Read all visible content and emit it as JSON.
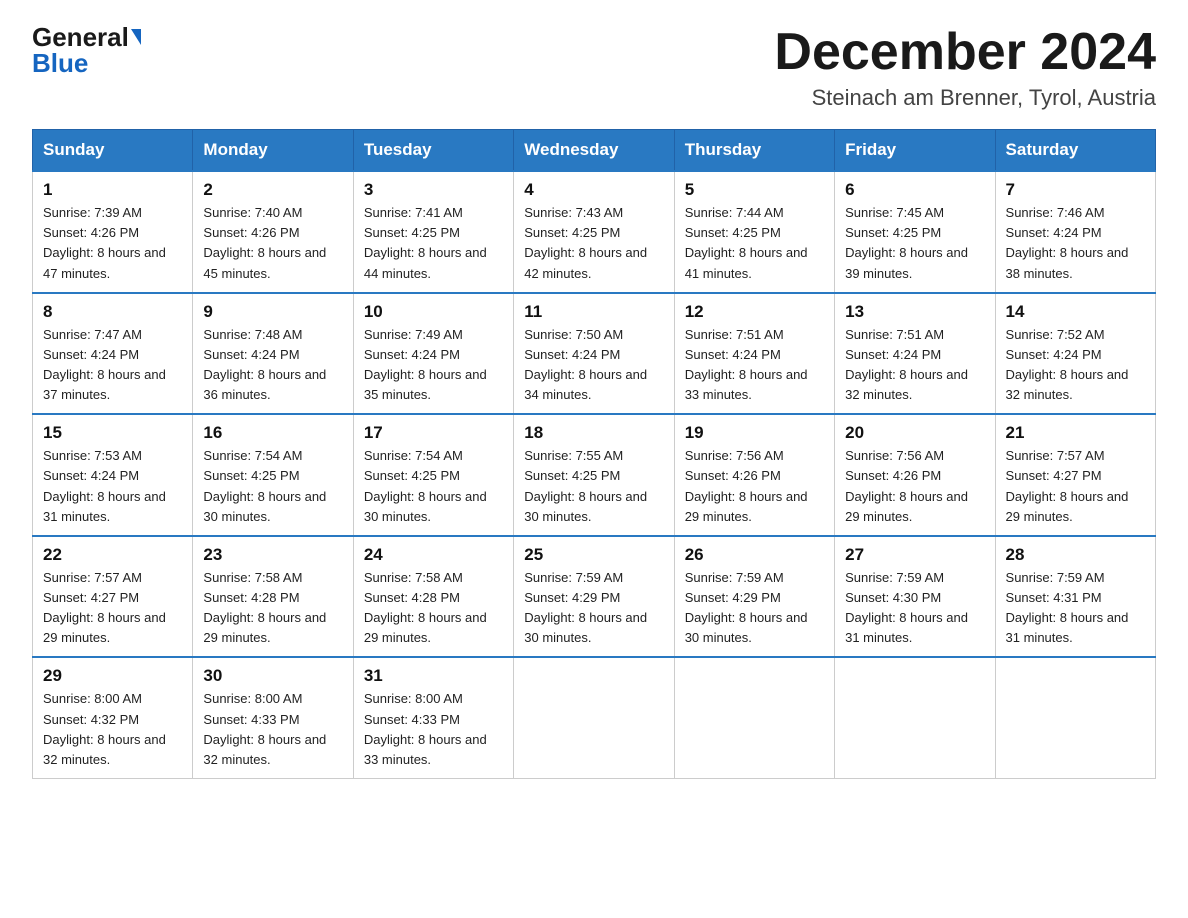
{
  "logo": {
    "general": "General",
    "blue": "Blue"
  },
  "title": "December 2024",
  "location": "Steinach am Brenner, Tyrol, Austria",
  "weekdays": [
    "Sunday",
    "Monday",
    "Tuesday",
    "Wednesday",
    "Thursday",
    "Friday",
    "Saturday"
  ],
  "weeks": [
    [
      {
        "day": "1",
        "sunrise": "7:39 AM",
        "sunset": "4:26 PM",
        "daylight": "8 hours and 47 minutes."
      },
      {
        "day": "2",
        "sunrise": "7:40 AM",
        "sunset": "4:26 PM",
        "daylight": "8 hours and 45 minutes."
      },
      {
        "day": "3",
        "sunrise": "7:41 AM",
        "sunset": "4:25 PM",
        "daylight": "8 hours and 44 minutes."
      },
      {
        "day": "4",
        "sunrise": "7:43 AM",
        "sunset": "4:25 PM",
        "daylight": "8 hours and 42 minutes."
      },
      {
        "day": "5",
        "sunrise": "7:44 AM",
        "sunset": "4:25 PM",
        "daylight": "8 hours and 41 minutes."
      },
      {
        "day": "6",
        "sunrise": "7:45 AM",
        "sunset": "4:25 PM",
        "daylight": "8 hours and 39 minutes."
      },
      {
        "day": "7",
        "sunrise": "7:46 AM",
        "sunset": "4:24 PM",
        "daylight": "8 hours and 38 minutes."
      }
    ],
    [
      {
        "day": "8",
        "sunrise": "7:47 AM",
        "sunset": "4:24 PM",
        "daylight": "8 hours and 37 minutes."
      },
      {
        "day": "9",
        "sunrise": "7:48 AM",
        "sunset": "4:24 PM",
        "daylight": "8 hours and 36 minutes."
      },
      {
        "day": "10",
        "sunrise": "7:49 AM",
        "sunset": "4:24 PM",
        "daylight": "8 hours and 35 minutes."
      },
      {
        "day": "11",
        "sunrise": "7:50 AM",
        "sunset": "4:24 PM",
        "daylight": "8 hours and 34 minutes."
      },
      {
        "day": "12",
        "sunrise": "7:51 AM",
        "sunset": "4:24 PM",
        "daylight": "8 hours and 33 minutes."
      },
      {
        "day": "13",
        "sunrise": "7:51 AM",
        "sunset": "4:24 PM",
        "daylight": "8 hours and 32 minutes."
      },
      {
        "day": "14",
        "sunrise": "7:52 AM",
        "sunset": "4:24 PM",
        "daylight": "8 hours and 32 minutes."
      }
    ],
    [
      {
        "day": "15",
        "sunrise": "7:53 AM",
        "sunset": "4:24 PM",
        "daylight": "8 hours and 31 minutes."
      },
      {
        "day": "16",
        "sunrise": "7:54 AM",
        "sunset": "4:25 PM",
        "daylight": "8 hours and 30 minutes."
      },
      {
        "day": "17",
        "sunrise": "7:54 AM",
        "sunset": "4:25 PM",
        "daylight": "8 hours and 30 minutes."
      },
      {
        "day": "18",
        "sunrise": "7:55 AM",
        "sunset": "4:25 PM",
        "daylight": "8 hours and 30 minutes."
      },
      {
        "day": "19",
        "sunrise": "7:56 AM",
        "sunset": "4:26 PM",
        "daylight": "8 hours and 29 minutes."
      },
      {
        "day": "20",
        "sunrise": "7:56 AM",
        "sunset": "4:26 PM",
        "daylight": "8 hours and 29 minutes."
      },
      {
        "day": "21",
        "sunrise": "7:57 AM",
        "sunset": "4:27 PM",
        "daylight": "8 hours and 29 minutes."
      }
    ],
    [
      {
        "day": "22",
        "sunrise": "7:57 AM",
        "sunset": "4:27 PM",
        "daylight": "8 hours and 29 minutes."
      },
      {
        "day": "23",
        "sunrise": "7:58 AM",
        "sunset": "4:28 PM",
        "daylight": "8 hours and 29 minutes."
      },
      {
        "day": "24",
        "sunrise": "7:58 AM",
        "sunset": "4:28 PM",
        "daylight": "8 hours and 29 minutes."
      },
      {
        "day": "25",
        "sunrise": "7:59 AM",
        "sunset": "4:29 PM",
        "daylight": "8 hours and 30 minutes."
      },
      {
        "day": "26",
        "sunrise": "7:59 AM",
        "sunset": "4:29 PM",
        "daylight": "8 hours and 30 minutes."
      },
      {
        "day": "27",
        "sunrise": "7:59 AM",
        "sunset": "4:30 PM",
        "daylight": "8 hours and 31 minutes."
      },
      {
        "day": "28",
        "sunrise": "7:59 AM",
        "sunset": "4:31 PM",
        "daylight": "8 hours and 31 minutes."
      }
    ],
    [
      {
        "day": "29",
        "sunrise": "8:00 AM",
        "sunset": "4:32 PM",
        "daylight": "8 hours and 32 minutes."
      },
      {
        "day": "30",
        "sunrise": "8:00 AM",
        "sunset": "4:33 PM",
        "daylight": "8 hours and 32 minutes."
      },
      {
        "day": "31",
        "sunrise": "8:00 AM",
        "sunset": "4:33 PM",
        "daylight": "8 hours and 33 minutes."
      },
      null,
      null,
      null,
      null
    ]
  ]
}
